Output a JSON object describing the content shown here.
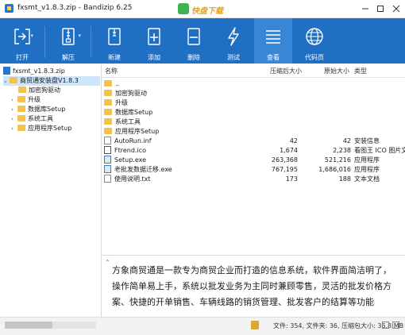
{
  "window": {
    "title": "fxsmt_v1.8.3.zip - Bandizip 6.25",
    "watermark": "快盘下载"
  },
  "toolbar": {
    "buttons": [
      {
        "label": "打开",
        "icon": "open-icon"
      },
      {
        "label": "解压",
        "icon": "extract-icon"
      },
      {
        "label": "新建",
        "icon": "new-archive-icon"
      },
      {
        "label": "添加",
        "icon": "add-icon"
      },
      {
        "label": "删除",
        "icon": "delete-icon"
      },
      {
        "label": "测试",
        "icon": "test-icon"
      },
      {
        "label": "查看",
        "icon": "view-icon"
      },
      {
        "label": "代码页",
        "icon": "codepage-icon"
      }
    ]
  },
  "tree": {
    "root": "fxsmt_v1.8.3.zip",
    "folder": "商贸通安装盘V1.8.3",
    "children": [
      "加密狗驱动",
      "升级",
      "数据库Setup",
      "系统工具",
      "应用程序Setup"
    ]
  },
  "list": {
    "headers": {
      "name": "名称",
      "compressed": "压缩后大小",
      "original": "原始大小",
      "type": "类型"
    },
    "rows": [
      {
        "name": "..",
        "compressed": "",
        "original": "",
        "type": "",
        "kind": "up"
      },
      {
        "name": "加密狗驱动",
        "compressed": "",
        "original": "",
        "type": "",
        "kind": "folder"
      },
      {
        "name": "升级",
        "compressed": "",
        "original": "",
        "type": "",
        "kind": "folder"
      },
      {
        "name": "数据库Setup",
        "compressed": "",
        "original": "",
        "type": "",
        "kind": "folder"
      },
      {
        "name": "系统工具",
        "compressed": "",
        "original": "",
        "type": "",
        "kind": "folder"
      },
      {
        "name": "应用程序Setup",
        "compressed": "",
        "original": "",
        "type": "",
        "kind": "folder"
      },
      {
        "name": "AutoRun.inf",
        "compressed": "42",
        "original": "42",
        "type": "安装信息",
        "kind": "file"
      },
      {
        "name": "Ftrend.ico",
        "compressed": "1,674",
        "original": "2,238",
        "type": "看图王 ICO 图片文",
        "kind": "ico"
      },
      {
        "name": "Setup.exe",
        "compressed": "263,368",
        "original": "521,216",
        "type": "应用程序",
        "kind": "exe"
      },
      {
        "name": "老批发数据迁移.exe",
        "compressed": "767,195",
        "original": "1,686,016",
        "type": "应用程序",
        "kind": "exe"
      },
      {
        "name": "使用说明.txt",
        "compressed": "173",
        "original": "188",
        "type": "文本文档",
        "kind": "file"
      }
    ]
  },
  "description": {
    "text": "方象商贸通是一款专为商贸企业而打造的信息系统，软件界面简洁明了，操作简单易上手，系统以批发业务为主同时兼顾零售，灵活的批发价格方案、快捷的开单销售、车辆线路的销货管理、批发客户的结算等功能"
  },
  "status": {
    "text": "文件: 354, 文件夹: 36, 压缩包大小: 36.8 MB"
  }
}
